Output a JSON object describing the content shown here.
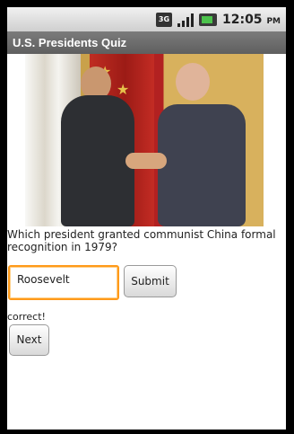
{
  "status_bar": {
    "network": "3G",
    "time": "12:05",
    "ampm": "PM"
  },
  "app": {
    "title": "U.S. Presidents Quiz"
  },
  "quiz": {
    "question": "Which president granted communist China formal recognition in 1979?",
    "answer_value": "Roosevelt",
    "submit_label": "Submit",
    "result_text": "correct!",
    "next_label": "Next"
  },
  "icons": {
    "signal": "signal-strength-icon",
    "network": "3g-icon",
    "battery": "battery-icon"
  }
}
